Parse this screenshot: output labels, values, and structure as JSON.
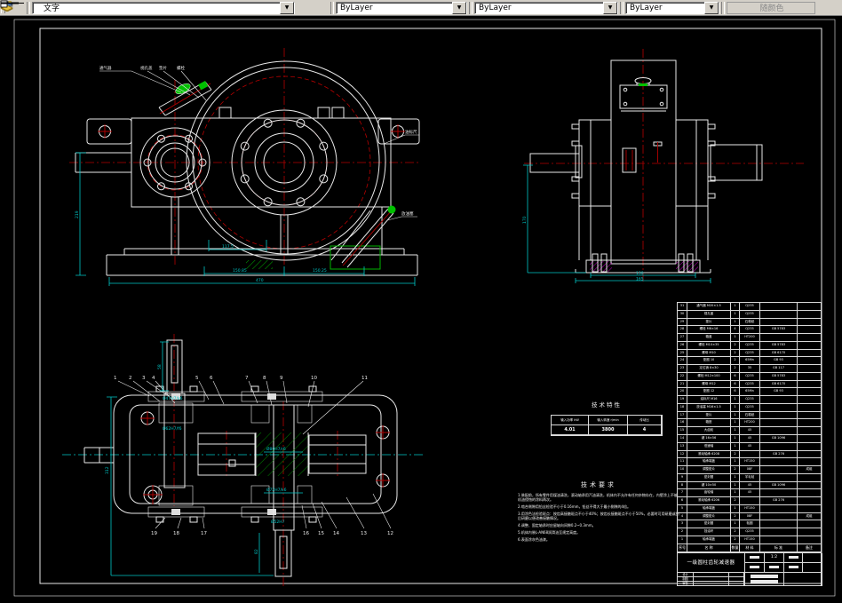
{
  "toolbar": {
    "layer": {
      "name": "文字"
    },
    "color": {
      "value": "ByLayer"
    },
    "linetype": {
      "value": "ByLayer"
    },
    "lineweight": {
      "value": "ByLayer"
    },
    "plot_style": {
      "value": "随颜色"
    },
    "arrow_glyph": "▼"
  },
  "colors": {
    "line": "#e9e9e9",
    "center": "#b40000",
    "dim": "#00c6c6",
    "hatch_green": "#00b400",
    "hatch_magenta": "#c000c0"
  },
  "drawing": {
    "front_callouts": [
      "通气器",
      "视孔盖",
      "垫片",
      "螺栓",
      "油标尺",
      "放油塞"
    ],
    "front_dims": [
      "117.5",
      "150.85",
      "150.25",
      "470",
      "219"
    ],
    "side_dims": [
      "170",
      "130",
      "165"
    ],
    "section_dims": [
      "312",
      "58",
      "82",
      "Ø47H7/k6",
      "Ø62H7/f6",
      "Ø80H7/r6",
      "Ø72H7/k6",
      "Ø52H7"
    ],
    "balloons_top": [
      "1",
      "2",
      "3",
      "4",
      "5",
      "6",
      "7",
      "8",
      "9",
      "10",
      "11"
    ],
    "balloons_bottom": [
      "19",
      "18",
      "17",
      "16",
      "15",
      "14",
      "13",
      "12"
    ],
    "tech_characteristics": {
      "title": "技术特性",
      "headers": [
        "输入功率 kW",
        "输入转速 r/min",
        "传动比"
      ],
      "values": [
        "4.01",
        "3800",
        "4"
      ]
    },
    "tech_requirements": {
      "title": "技术要求",
      "lines": [
        "1.装配前，所有零件用煤油清洗，滚动轴承用汽油清洗，机体内不允许有任何杂物存在，内壁涂上不被机油侵蚀的涂料两次。",
        "2.啮合侧隙用铅丝检验不小于0.16mm，铅丝不得大于最小侧隙的4倍。",
        "3.用涂色法检验斑点：按齿高接触斑点不小于40%；按齿长接触斑点不小于50%，必要时可用研磨或刮后研磨以便改善接触情况。",
        "4.调整、固定轴承时应留轴向间隙0.2~0.3mm。",
        "5.机体内装L-AN68润滑油至规定高度。",
        "6.表面涂灰色油漆。"
      ]
    },
    "bom": {
      "header": [
        "序号",
        "名  称",
        "数量",
        "材 料",
        "标 准",
        "备注"
      ],
      "rows": [
        [
          "31",
          "通气器 M20×1.5",
          "1",
          "Q235",
          "",
          ""
        ],
        [
          "30",
          "视孔盖",
          "1",
          "Q235",
          "",
          ""
        ],
        [
          "29",
          "垫片",
          "1",
          "石棉纸",
          "",
          ""
        ],
        [
          "28",
          "螺栓 M6×16",
          "4",
          "Q235",
          "GB 5783",
          ""
        ],
        [
          "27",
          "箱盖",
          "1",
          "HT200",
          "",
          ""
        ],
        [
          "26",
          "螺栓 M10×35",
          "2",
          "Q235",
          "GB 5783",
          ""
        ],
        [
          "25",
          "螺母 M10",
          "2",
          "Q235",
          "GB 6170",
          ""
        ],
        [
          "24",
          "垫圈 10",
          "2",
          "65Mn",
          "GB 93",
          ""
        ],
        [
          "23",
          "定位销 8×30",
          "2",
          "35",
          "GB 117",
          ""
        ],
        [
          "22",
          "螺栓 M12×100",
          "6",
          "Q235",
          "GB 5783",
          ""
        ],
        [
          "21",
          "螺母 M12",
          "6",
          "Q235",
          "GB 6170",
          ""
        ],
        [
          "20",
          "垫圈 12",
          "6",
          "65Mn",
          "GB 93",
          ""
        ],
        [
          "19",
          "油标尺 M16",
          "1",
          "Q235",
          "",
          ""
        ],
        [
          "18",
          "放油塞 M16×1.5",
          "1",
          "Q235",
          "",
          ""
        ],
        [
          "17",
          "垫片",
          "1",
          "石棉纸",
          "",
          ""
        ],
        [
          "16",
          "箱座",
          "1",
          "HT200",
          "",
          ""
        ],
        [
          "15",
          "大齿轮",
          "1",
          "45",
          "",
          ""
        ],
        [
          "14",
          "键 16×56",
          "1",
          "45",
          "GB 1096",
          ""
        ],
        [
          "13",
          "低速轴",
          "1",
          "45",
          "",
          ""
        ],
        [
          "12",
          "滚动轴承 6208",
          "2",
          "",
          "GB 276",
          ""
        ],
        [
          "11",
          "轴承端盖",
          "1",
          "HT150",
          "",
          ""
        ],
        [
          "10",
          "调整垫片",
          "2",
          "08F",
          "",
          "成组"
        ],
        [
          "9",
          "密封圈",
          "1",
          "羊毛毡",
          "",
          ""
        ],
        [
          "8",
          "键 10×50",
          "1",
          "45",
          "GB 1096",
          ""
        ],
        [
          "7",
          "齿轮轴",
          "1",
          "45",
          "",
          ""
        ],
        [
          "6",
          "滚动轴承 6206",
          "2",
          "",
          "GB 276",
          ""
        ],
        [
          "5",
          "轴承端盖",
          "1",
          "HT150",
          "",
          ""
        ],
        [
          "4",
          "调整垫片",
          "2",
          "08F",
          "",
          "成组"
        ],
        [
          "3",
          "密封圈",
          "1",
          "毡圈",
          "",
          ""
        ],
        [
          "2",
          "挡油环",
          "2",
          "Q235",
          "",
          ""
        ],
        [
          "1",
          "轴承端盖",
          "2",
          "HT150",
          "",
          ""
        ]
      ]
    },
    "title_block": {
      "product": "一级圆柱齿轮减速器",
      "scale": "1:2",
      "signoff": [
        "设计",
        "制图",
        "审核"
      ]
    }
  }
}
